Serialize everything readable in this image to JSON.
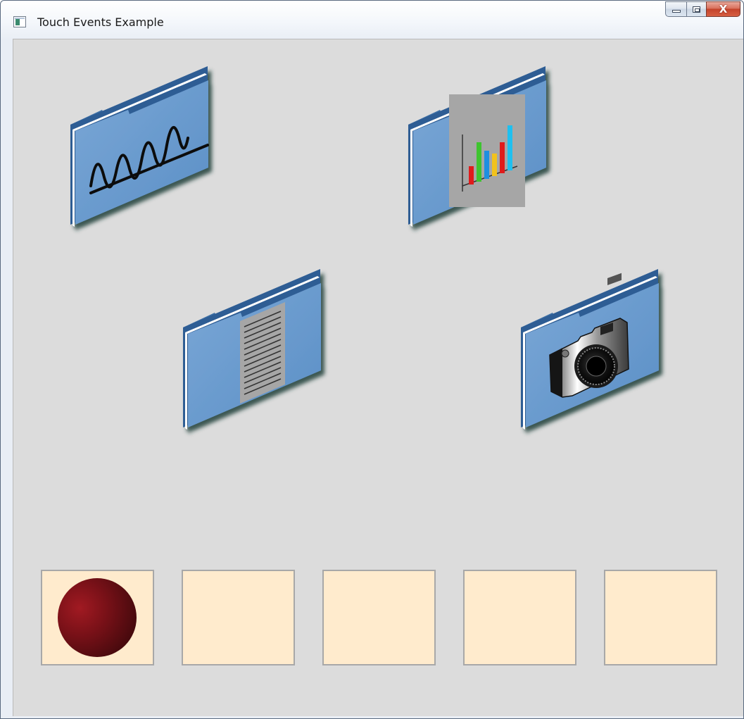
{
  "window": {
    "title": "Touch Events Example",
    "controls": {
      "close_glyph": "X"
    }
  },
  "folders": [
    {
      "name": "waveform-folder",
      "content_icon": "sine-wave-icon"
    },
    {
      "name": "chart-folder",
      "content_icon": "bar-chart-icon"
    },
    {
      "name": "document-folder",
      "content_icon": "document-icon"
    },
    {
      "name": "camera-folder",
      "content_icon": "camera-icon"
    }
  ],
  "slots": [
    {
      "has_ball": true
    },
    {
      "has_ball": false
    },
    {
      "has_ball": false
    },
    {
      "has_ball": false
    },
    {
      "has_ball": false
    }
  ],
  "colors": {
    "client_background": "#dcdcdc",
    "folder_blue": "#6699cc",
    "slot_fill": "#ffebcd",
    "ball": "#7a1118"
  }
}
